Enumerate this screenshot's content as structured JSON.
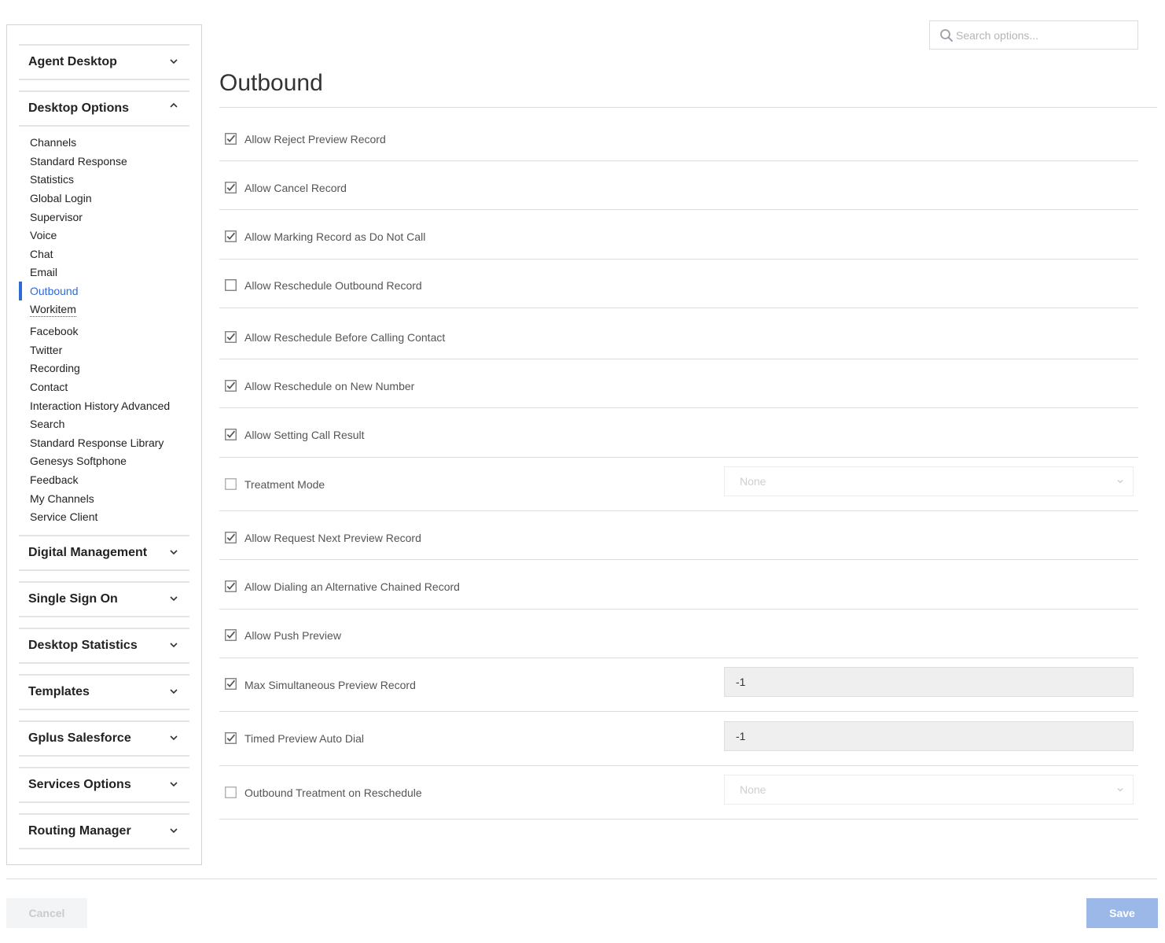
{
  "search": {
    "placeholder": "Search options..."
  },
  "sidebar": {
    "sections": [
      {
        "label": "Agent Desktop",
        "expanded": false
      },
      {
        "label": "Desktop Options",
        "expanded": true
      },
      {
        "label": "Digital Management",
        "expanded": false
      },
      {
        "label": "Single Sign On",
        "expanded": false
      },
      {
        "label": "Desktop Statistics",
        "expanded": false
      },
      {
        "label": "Templates",
        "expanded": false
      },
      {
        "label": "Gplus Salesforce",
        "expanded": false
      },
      {
        "label": "Services Options",
        "expanded": false
      },
      {
        "label": "Routing Manager",
        "expanded": false
      }
    ],
    "desktop_options_items": [
      "Channels",
      "Standard Response",
      "Statistics",
      "Global Login",
      "Supervisor",
      "Voice",
      "Chat",
      "Email",
      "Outbound",
      "Workitem",
      "Facebook",
      "Twitter",
      "Recording",
      "Contact",
      "Interaction History Advanced",
      "Search",
      "Standard Response Library",
      "Genesys Softphone",
      "Feedback",
      "My Channels",
      "Service Client"
    ],
    "active_item": "Outbound"
  },
  "main": {
    "title": "Outbound",
    "options": [
      {
        "label": "Allow Reject Preview Record",
        "checked": true
      },
      {
        "label": "Allow Cancel Record",
        "checked": true
      },
      {
        "label": "Allow Marking Record as Do Not Call",
        "checked": true
      },
      {
        "label": "Allow Reschedule Outbound Record",
        "checked": false
      },
      {
        "label": "Allow Reschedule Before Calling Contact",
        "checked": true
      },
      {
        "label": "Allow Reschedule on New Number",
        "checked": true
      },
      {
        "label": "Allow Setting Call Result",
        "checked": true
      },
      {
        "label": "Treatment Mode",
        "checked": false,
        "control": "select",
        "value": "None"
      },
      {
        "label": "Allow Request Next Preview Record",
        "checked": true
      },
      {
        "label": "Allow Dialing an Alternative Chained Record",
        "checked": true
      },
      {
        "label": "Allow Push Preview",
        "checked": true
      },
      {
        "label": "Max Simultaneous Preview Record",
        "checked": true,
        "control": "input",
        "value": "-1"
      },
      {
        "label": "Timed Preview Auto Dial",
        "checked": true,
        "control": "input",
        "value": "-1"
      },
      {
        "label": "Outbound Treatment on Reschedule",
        "checked": false,
        "control": "select",
        "value": "None"
      }
    ]
  },
  "footer": {
    "cancel_label": "Cancel",
    "save_label": "Save"
  },
  "colors": {
    "accent": "#2e6bd6",
    "save_button": "#9bb8e8",
    "divider": "#dcdcdc"
  }
}
